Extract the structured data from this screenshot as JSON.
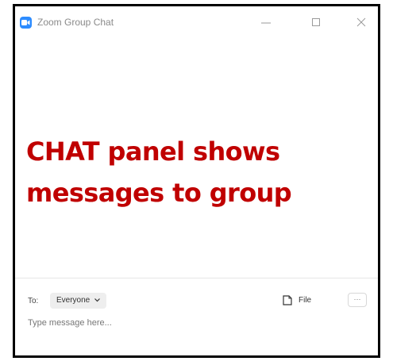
{
  "window": {
    "title": "Zoom Group Chat",
    "icon": "zoom-icon",
    "controls": [
      "minimize-icon",
      "maximize-icon",
      "close-icon"
    ]
  },
  "annotation": {
    "line1": "CHAT panel shows",
    "line2": "messages to group",
    "color": "#c00000"
  },
  "composer": {
    "to_label": "To:",
    "recipient": "Everyone",
    "file_label": "File",
    "more_label": "···",
    "placeholder": "Type message here..."
  },
  "colors": {
    "zoom_blue": "#2d8cff",
    "frame": "#000000"
  }
}
